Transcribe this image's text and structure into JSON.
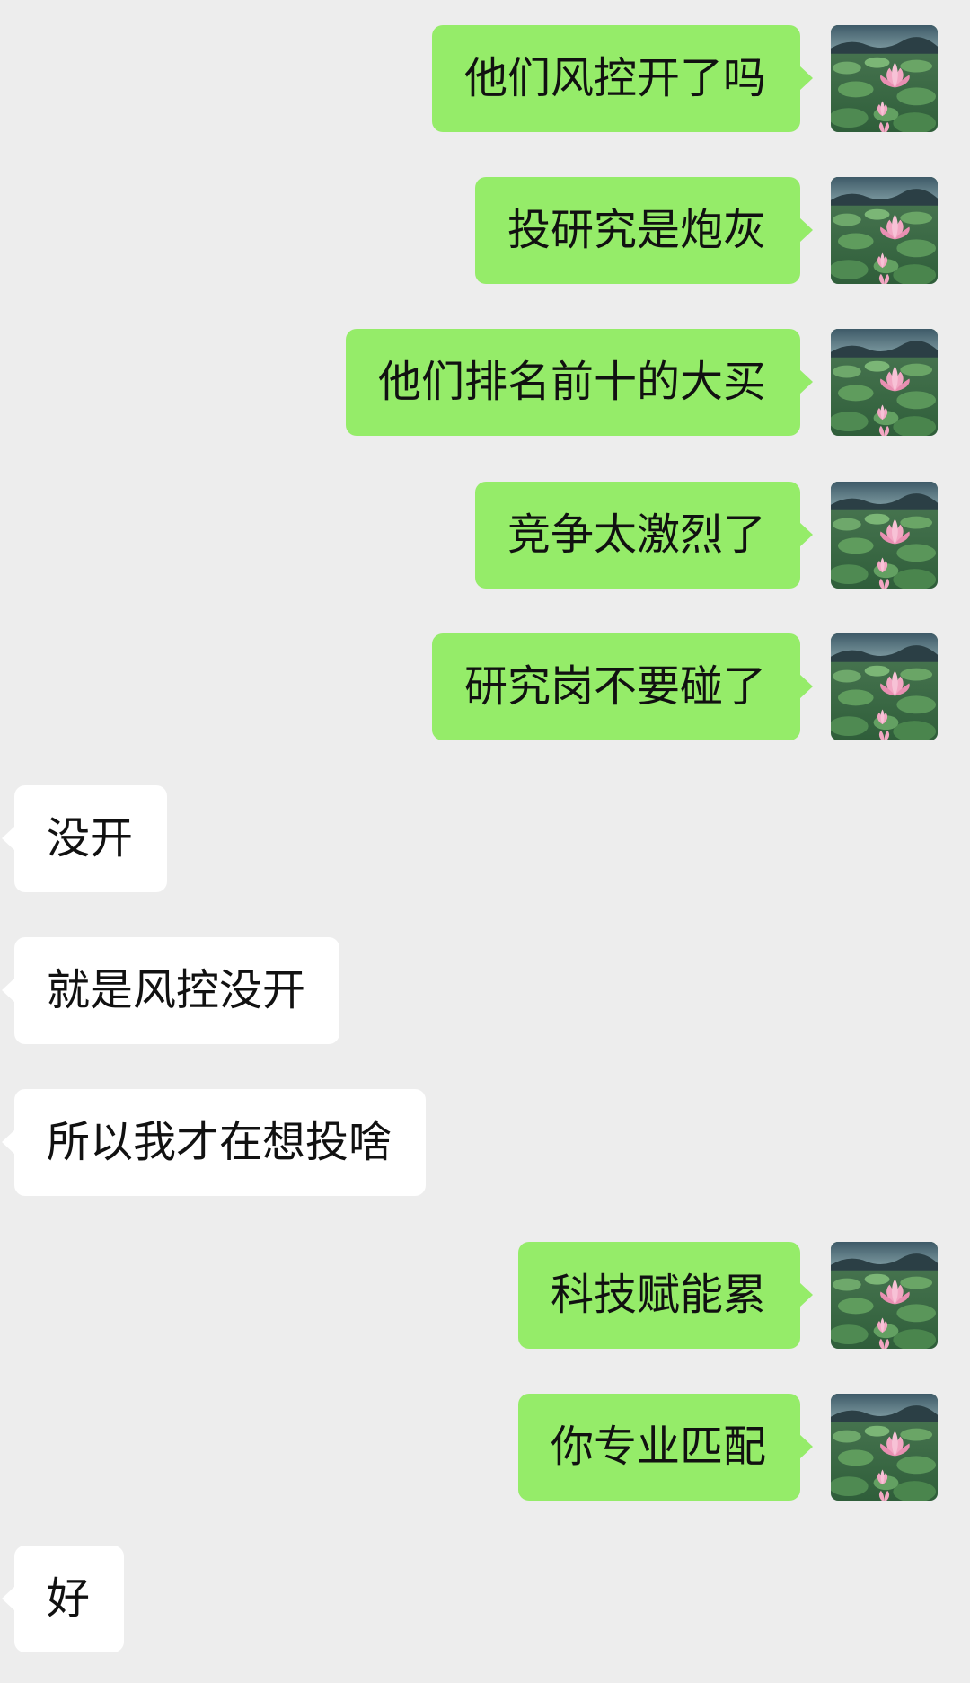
{
  "messages": [
    {
      "direction": "outgoing",
      "text": "他们风控开了吗"
    },
    {
      "direction": "outgoing",
      "text": "投研究是炮灰"
    },
    {
      "direction": "outgoing",
      "text": "他们排名前十的大买"
    },
    {
      "direction": "outgoing",
      "text": "竞争太激烈了"
    },
    {
      "direction": "outgoing",
      "text": "研究岗不要碰了"
    },
    {
      "direction": "incoming",
      "text": "没开"
    },
    {
      "direction": "incoming",
      "text": "就是风控没开"
    },
    {
      "direction": "incoming",
      "text": "所以我才在想投啥"
    },
    {
      "direction": "outgoing",
      "text": "科技赋能累"
    },
    {
      "direction": "outgoing",
      "text": "你专业匹配"
    },
    {
      "direction": "incoming",
      "text": "好"
    }
  ],
  "avatar": {
    "icon": "lotus-pond-avatar-icon"
  },
  "colors": {
    "background": "#ededed",
    "outgoing_bubble": "#95ec69",
    "incoming_bubble": "#ffffff",
    "text": "#111111"
  }
}
